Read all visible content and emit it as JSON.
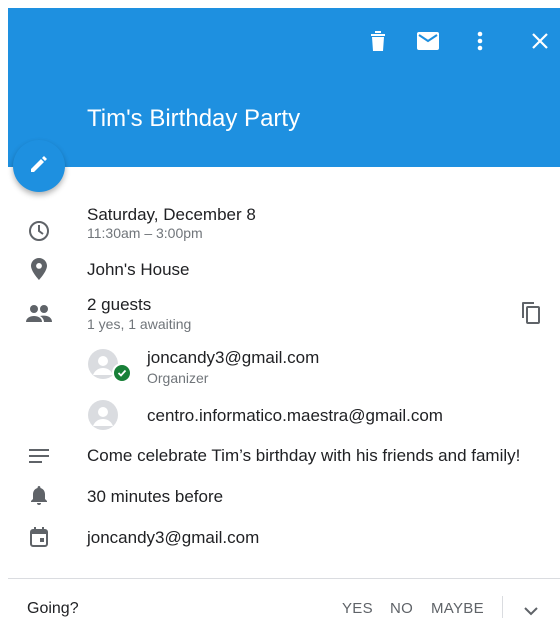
{
  "header": {
    "title": "Tim's Birthday Party",
    "color": "#1e90e0"
  },
  "toolbar": {
    "icons": [
      "delete-icon",
      "email-icon",
      "more-vert-icon",
      "close-icon"
    ]
  },
  "fab": {
    "icon": "edit-icon"
  },
  "event": {
    "date": "Saturday, December 8",
    "time": "11:30am – 3:00pm",
    "location": "John's House",
    "guests_count": "2 guests",
    "guests_status": "1 yes, 1 awaiting",
    "guests": [
      {
        "email": "joncandy3@gmail.com",
        "role": "Organizer",
        "status": "accepted"
      },
      {
        "email": "centro.informatico.maestra@gmail.com",
        "role": "",
        "status": "awaiting"
      }
    ],
    "description": "Come celebrate Tim’s birthday with his friends and family!",
    "notification": "30 minutes before",
    "calendar": "joncandy3@gmail.com"
  },
  "rsvp": {
    "prompt": "Going?",
    "yes": "YES",
    "no": "NO",
    "maybe": "MAYBE"
  }
}
